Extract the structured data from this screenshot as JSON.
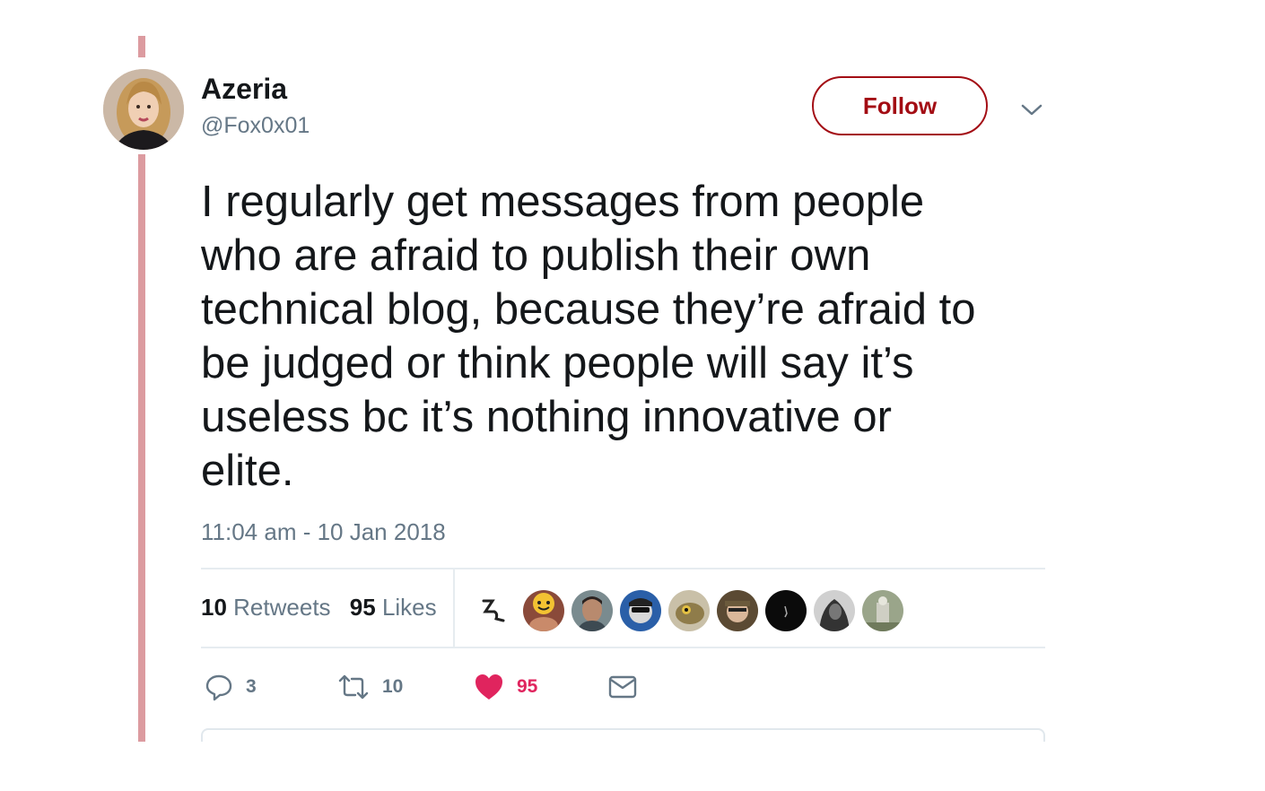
{
  "tweet": {
    "author_name": "Azeria",
    "author_handle": "@Fox0x01",
    "follow_label": "Follow",
    "text": "I regularly get messages from people\nwho are afraid to publish their own\ntechnical blog, because they’re afraid to\nbe judged or think people will say it’s\nuseless bc it’s nothing innovative or\nelite.",
    "timestamp": "11:04 am - 10 Jan 2018"
  },
  "stats": {
    "retweets_count": "10",
    "retweets_label": "Retweets",
    "likes_count": "95",
    "likes_label": "Likes"
  },
  "actions": {
    "replies": "3",
    "retweets": "10",
    "likes": "95"
  },
  "icons": {
    "reply": "reply-icon",
    "retweet": "retweet-icon",
    "like": "heart-icon",
    "dm": "envelope-icon",
    "more": "chevron-down-icon"
  },
  "colors": {
    "thread_line": "#dc9ba0",
    "follow_accent": "#a30d14",
    "like": "#e0245e",
    "muted_text": "#657786"
  }
}
